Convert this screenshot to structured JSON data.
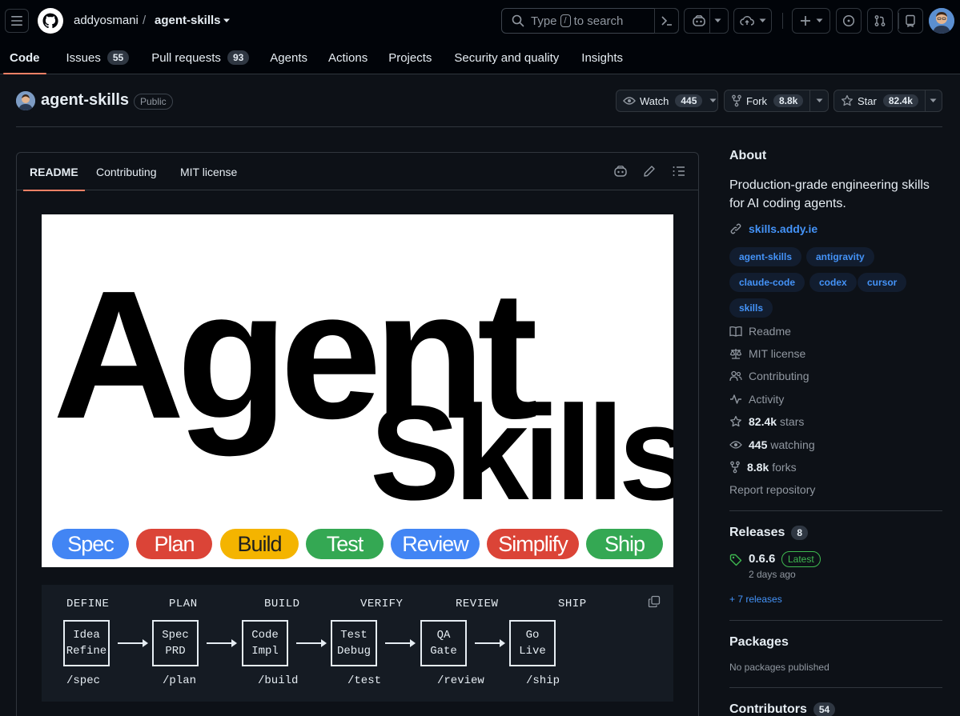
{
  "header": {
    "owner": "addyosmani",
    "separator": "/",
    "repo": "agent-skills",
    "search_prefix": "Type",
    "search_key": "/",
    "search_suffix": "to search"
  },
  "tabs": [
    {
      "label": "Code"
    },
    {
      "label": "Issues",
      "count": "55"
    },
    {
      "label": "Pull requests",
      "count": "93"
    },
    {
      "label": "Agents"
    },
    {
      "label": "Actions"
    },
    {
      "label": "Projects"
    },
    {
      "label": "Security and quality"
    },
    {
      "label": "Insights"
    }
  ],
  "repo": {
    "name": "agent-skills",
    "visibility": "Public",
    "watch_label": "Watch",
    "watch_count": "445",
    "fork_label": "Fork",
    "fork_count": "8.8k",
    "star_label": "Star",
    "star_count": "82.4k"
  },
  "readme": {
    "tabs": [
      "README",
      "Contributing",
      "MIT license"
    ],
    "hero_word1": "Agent",
    "hero_word2": "Skills",
    "pills": [
      {
        "label": "Spec",
        "color": "#4285f4"
      },
      {
        "label": "Plan",
        "color": "#db4437"
      },
      {
        "label": "Build",
        "color": "#f4b400"
      },
      {
        "label": "Test",
        "color": "#34a853"
      },
      {
        "label": "Review",
        "color": "#4285f4"
      },
      {
        "label": "Simplify",
        "color": "#db4437"
      },
      {
        "label": "Ship",
        "color": "#34a853"
      }
    ],
    "flow": [
      {
        "stage": "DEFINE",
        "line1": "Idea",
        "line2": "Refine",
        "cmd": "/spec"
      },
      {
        "stage": "PLAN",
        "line1": "Spec",
        "line2": "PRD",
        "cmd": "/plan"
      },
      {
        "stage": "BUILD",
        "line1": "Code",
        "line2": "Impl",
        "cmd": "/build"
      },
      {
        "stage": "VERIFY",
        "line1": "Test",
        "line2": "Debug",
        "cmd": "/test"
      },
      {
        "stage": "REVIEW",
        "line1": "QA",
        "line2": "Gate",
        "cmd": "/review"
      },
      {
        "stage": "SHIP",
        "line1": "Go",
        "line2": "Live",
        "cmd": "/ship"
      }
    ]
  },
  "about": {
    "heading": "About",
    "description_line1": "Production-grade engineering skills",
    "description_line2": "for AI coding agents.",
    "website": "skills.addy.ie",
    "topics": [
      "agent-skills",
      "antigravity",
      "claude-code",
      "codex",
      "cursor",
      "skills"
    ],
    "links": {
      "readme": "Readme",
      "license": "MIT license",
      "contributing": "Contributing",
      "activity": "Activity",
      "stars_count": "82.4k",
      "stars_label": "stars",
      "watching_count": "445",
      "watching_label": "watching",
      "forks_count": "8.8k",
      "forks_label": "forks",
      "report": "Report repository"
    }
  },
  "releases": {
    "heading": "Releases",
    "count": "8",
    "latest_version": "0.6.6",
    "latest_badge": "Latest",
    "latest_date": "2 days ago",
    "more": "+ 7 releases"
  },
  "packages": {
    "heading": "Packages",
    "empty": "No packages published"
  },
  "contributors": {
    "heading": "Contributors",
    "count": "54"
  },
  "colors": {
    "accent_underline": "#f78166",
    "link": "#4493f8",
    "latest_green": "#3fb950"
  }
}
